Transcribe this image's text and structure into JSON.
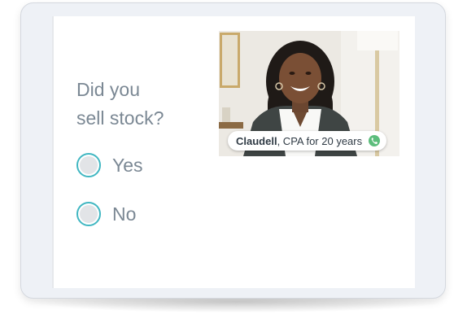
{
  "question": {
    "line1": "Did you",
    "line2": "sell stock?"
  },
  "options": [
    {
      "label": "Yes",
      "selected": false
    },
    {
      "label": "No",
      "selected": false
    }
  ],
  "expert_caption": {
    "name": "Claudell",
    "credential": ", CPA for 20 years",
    "status_icon": "phone-icon"
  },
  "colors": {
    "radio_accent": "#41b7c2",
    "text_gray": "#7b8894",
    "status_green": "#5cbd7c"
  }
}
